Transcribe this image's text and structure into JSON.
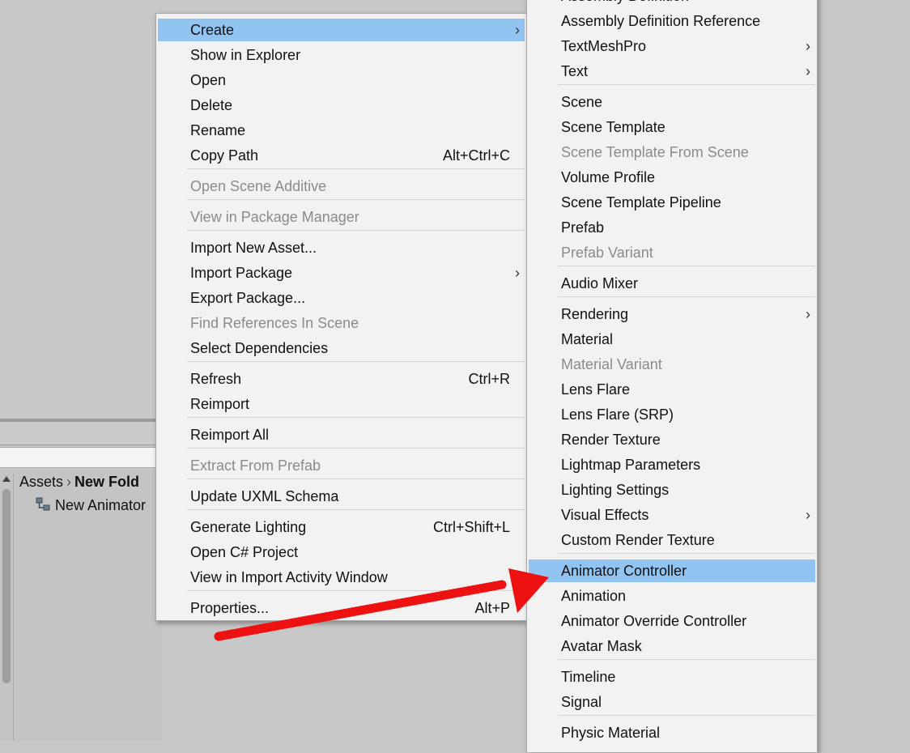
{
  "project": {
    "breadcrumb": [
      "Assets",
      "New Fold"
    ],
    "asset_item": "New Animator"
  },
  "context_menu": {
    "items": [
      {
        "label": "Create",
        "shortcut": "",
        "submenu": true,
        "highlight": true,
        "disabled": false
      },
      {
        "label": "Show in Explorer",
        "shortcut": "",
        "submenu": false,
        "disabled": false
      },
      {
        "label": "Open",
        "shortcut": "",
        "submenu": false,
        "disabled": false
      },
      {
        "label": "Delete",
        "shortcut": "",
        "submenu": false,
        "disabled": false
      },
      {
        "label": "Rename",
        "shortcut": "",
        "submenu": false,
        "disabled": false
      },
      {
        "label": "Copy Path",
        "shortcut": "Alt+Ctrl+C",
        "submenu": false,
        "disabled": false
      },
      {
        "label": "Open Scene Additive",
        "shortcut": "",
        "submenu": false,
        "disabled": true
      },
      {
        "label": "View in Package Manager",
        "shortcut": "",
        "submenu": false,
        "disabled": true
      },
      {
        "label": "Import New Asset...",
        "shortcut": "",
        "submenu": false,
        "disabled": false
      },
      {
        "label": "Import Package",
        "shortcut": "",
        "submenu": true,
        "disabled": false
      },
      {
        "label": "Export Package...",
        "shortcut": "",
        "submenu": false,
        "disabled": false
      },
      {
        "label": "Find References In Scene",
        "shortcut": "",
        "submenu": false,
        "disabled": true
      },
      {
        "label": "Select Dependencies",
        "shortcut": "",
        "submenu": false,
        "disabled": false
      },
      {
        "label": "Refresh",
        "shortcut": "Ctrl+R",
        "submenu": false,
        "disabled": false
      },
      {
        "label": "Reimport",
        "shortcut": "",
        "submenu": false,
        "disabled": false
      },
      {
        "label": "Reimport All",
        "shortcut": "",
        "submenu": false,
        "disabled": false
      },
      {
        "label": "Extract From Prefab",
        "shortcut": "",
        "submenu": false,
        "disabled": true
      },
      {
        "label": "Update UXML Schema",
        "shortcut": "",
        "submenu": false,
        "disabled": false
      },
      {
        "label": "Generate Lighting",
        "shortcut": "Ctrl+Shift+L",
        "submenu": false,
        "disabled": false
      },
      {
        "label": "Open C# Project",
        "shortcut": "",
        "submenu": false,
        "disabled": false
      },
      {
        "label": "View in Import Activity Window",
        "shortcut": "",
        "submenu": false,
        "disabled": false
      },
      {
        "label": "Properties...",
        "shortcut": "Alt+P",
        "submenu": false,
        "disabled": false
      }
    ]
  },
  "create_submenu": {
    "items": [
      {
        "label": "Assembly Definition",
        "submenu": false,
        "disabled": false
      },
      {
        "label": "Assembly Definition Reference",
        "submenu": false,
        "disabled": false
      },
      {
        "label": "TextMeshPro",
        "submenu": true,
        "disabled": false
      },
      {
        "label": "Text",
        "submenu": true,
        "disabled": false
      },
      {
        "label": "Scene",
        "submenu": false,
        "disabled": false
      },
      {
        "label": "Scene Template",
        "submenu": false,
        "disabled": false
      },
      {
        "label": "Scene Template From Scene",
        "submenu": false,
        "disabled": true
      },
      {
        "label": "Volume Profile",
        "submenu": false,
        "disabled": false
      },
      {
        "label": "Scene Template Pipeline",
        "submenu": false,
        "disabled": false
      },
      {
        "label": "Prefab",
        "submenu": false,
        "disabled": false
      },
      {
        "label": "Prefab Variant",
        "submenu": false,
        "disabled": true
      },
      {
        "label": "Audio Mixer",
        "submenu": false,
        "disabled": false
      },
      {
        "label": "Rendering",
        "submenu": true,
        "disabled": false
      },
      {
        "label": "Material",
        "submenu": false,
        "disabled": false
      },
      {
        "label": "Material Variant",
        "submenu": false,
        "disabled": true
      },
      {
        "label": "Lens Flare",
        "submenu": false,
        "disabled": false
      },
      {
        "label": "Lens Flare (SRP)",
        "submenu": false,
        "disabled": false
      },
      {
        "label": "Render Texture",
        "submenu": false,
        "disabled": false
      },
      {
        "label": "Lightmap Parameters",
        "submenu": false,
        "disabled": false
      },
      {
        "label": "Lighting Settings",
        "submenu": false,
        "disabled": false
      },
      {
        "label": "Visual Effects",
        "submenu": true,
        "disabled": false
      },
      {
        "label": "Custom Render Texture",
        "submenu": false,
        "disabled": false
      },
      {
        "label": "Animator Controller",
        "submenu": false,
        "disabled": false,
        "highlight": true
      },
      {
        "label": "Animation",
        "submenu": false,
        "disabled": false
      },
      {
        "label": "Animator Override Controller",
        "submenu": false,
        "disabled": false
      },
      {
        "label": "Avatar Mask",
        "submenu": false,
        "disabled": false
      },
      {
        "label": "Timeline",
        "submenu": false,
        "disabled": false
      },
      {
        "label": "Signal",
        "submenu": false,
        "disabled": false
      },
      {
        "label": "Physic Material",
        "submenu": false,
        "disabled": false
      }
    ]
  },
  "colors": {
    "highlight": "#92c4f2",
    "menu_bg": "#f2f2f2",
    "disabled_text": "#8b8b8b",
    "annotation_arrow": "#ee1111"
  },
  "icons": {
    "submenu_arrow": "chevron-right-icon",
    "asset": "animator-controller-icon",
    "breadcrumb_separator": "chevron-right-icon"
  }
}
